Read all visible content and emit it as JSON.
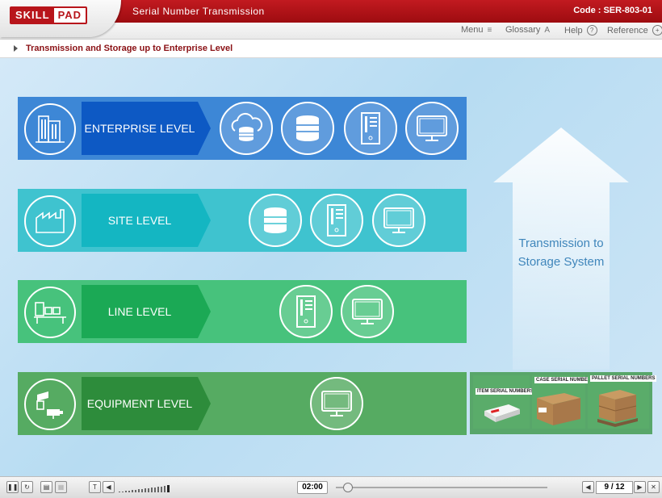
{
  "header": {
    "logo_left": "SKILL",
    "logo_right": "PAD",
    "title": "Serial Number Transmission",
    "code": "Code :  SER-803-01"
  },
  "toolbar": {
    "menu": "Menu",
    "glossary": "Glossary",
    "glossary_icon_text": "A",
    "help": "Help",
    "help_icon_text": "?",
    "reference": "Reference",
    "reference_icon_text": "+"
  },
  "breadcrumb": {
    "text": "Transmission and Storage up to Enterprise Level"
  },
  "levels": [
    {
      "label": "ENTERPRISE LEVEL",
      "icon": "building-icon",
      "devices": [
        "cloud-database-icon",
        "database-icon",
        "server-icon",
        "monitor-icon"
      ]
    },
    {
      "label": "SITE LEVEL",
      "icon": "factory-icon",
      "devices": [
        "database-icon",
        "server-icon",
        "monitor-icon"
      ]
    },
    {
      "label": "LINE LEVEL",
      "icon": "conveyor-line-icon",
      "devices": [
        "server-icon",
        "monitor-icon"
      ]
    },
    {
      "label": "EQUIPMENT LEVEL",
      "icon": "printer-camera-icon",
      "devices": [
        "monitor-icon"
      ]
    }
  ],
  "arrow": {
    "text_line1": "Transmission to",
    "text_line2": "Storage System"
  },
  "packaging": {
    "item": "ITEM SERIAL NUMBERS",
    "case": "CASE SERIAL NUMBERS",
    "pallet": "PALLET SERIAL NUMBERS"
  },
  "player": {
    "time": "02:00",
    "page": "9 / 12"
  }
}
